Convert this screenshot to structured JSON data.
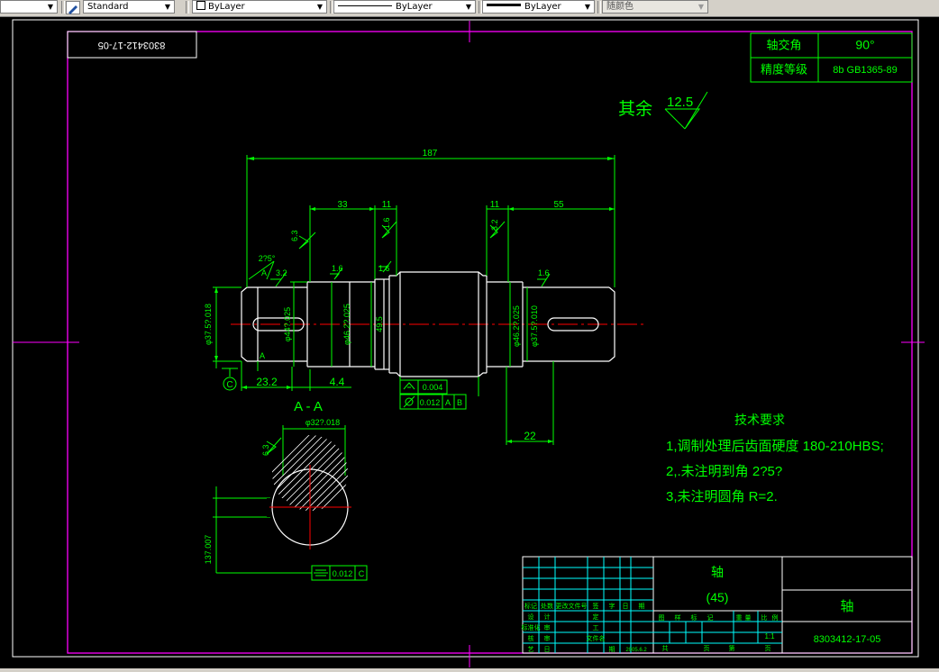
{
  "toolbar": {
    "textstyle": "Standard",
    "layer": "ByLayer",
    "linetype": "ByLayer",
    "lineweight": "ByLayer",
    "plotstyle": "随颜色"
  },
  "drawing": {
    "drawing_number_rotated": "8303412-17-05",
    "param_table": {
      "shaft_angle_label": "轴交角",
      "shaft_angle_value": "90°",
      "accuracy_label": "精度等级",
      "accuracy_value": "8b GB1365-89"
    },
    "roughness_general": {
      "label": "其余",
      "value": "12.5"
    },
    "dims": {
      "overall": "187",
      "d33": "33",
      "d11a": "11",
      "d11b": "11",
      "d55": "55",
      "d23_2": "23.2",
      "d4_4": "4.4",
      "d22": "22",
      "d49_5": "49.5",
      "angle": "2?5°",
      "dia_left_key": "φ37.5?.018",
      "dia_shoulder_1": "φ44?.025",
      "dia_mid": "φ46.2?.025",
      "dia_right_1": "φ46.2?.025",
      "dia_right_key": "φ37.5?.010",
      "section_dia": "φ32?.018",
      "section_depth": "137.007"
    },
    "roughness": {
      "r63a": "6.3",
      "r32a": "3.2",
      "r16a": "1.6",
      "r16b": "1.6",
      "r16c": "1.6",
      "r16d": "1.6",
      "r32b": "3.2",
      "r63b": "6.3"
    },
    "datum": {
      "c": "C",
      "a": "A"
    },
    "tolerance": {
      "runout_value": "0.004",
      "cyl_value": "0.012",
      "ref_a": "A",
      "ref_b": "B",
      "sym_value": "0.012",
      "ref_c": "C"
    },
    "section_label": "A - A",
    "notes": {
      "title": "技术要求",
      "line1": "1,调制处理后齿面硬度 180-210HBS;",
      "line2": "2,.未注明到角 2?5?",
      "line3": "3,未注明圆角 R=2."
    },
    "title_block": {
      "part_name": "轴",
      "material": "(45)",
      "drawing_title": "轴",
      "drawing_number": "8303412-17-05",
      "scale": "1:1",
      "headers": [
        "标记",
        "处数",
        "更改文件号",
        "签",
        "字",
        "日",
        "期"
      ],
      "rows": [
        "设",
        "计",
        "标准化",
        "审",
        "核",
        "审",
        "定",
        "工",
        "艺",
        "日",
        "期"
      ],
      "stage_labels": [
        "图",
        "样",
        "标",
        "记",
        "重",
        "量",
        "比",
        "例"
      ],
      "sheet_labels": [
        "共",
        "页",
        "第",
        "页"
      ],
      "date": "2005.6.2",
      "filename": "文件名"
    }
  }
}
